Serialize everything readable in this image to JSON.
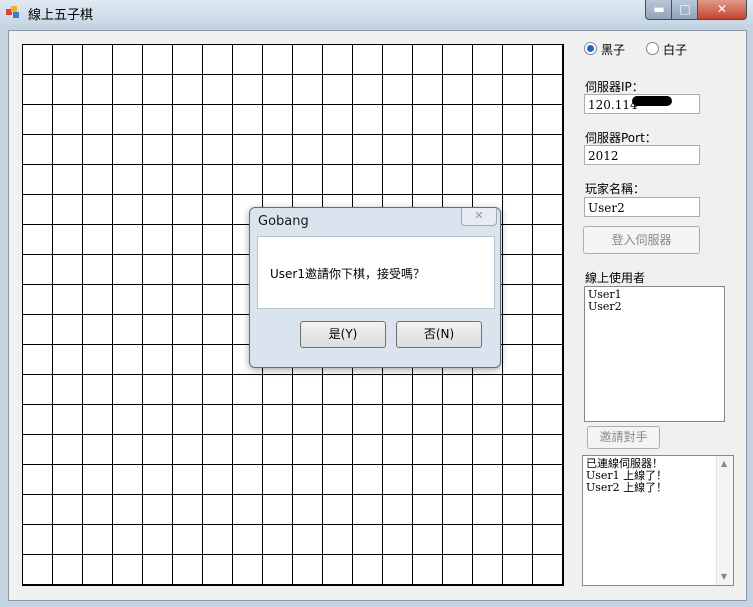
{
  "window": {
    "title": "線上五子棋"
  },
  "titlebar": {
    "min_glyph": "▬",
    "max_glyph": "□",
    "close_glyph": "✕"
  },
  "side": {
    "radio_black": "黑子",
    "radio_white": "白子",
    "selected": "黑子",
    "ip_label": "伺服器IP：",
    "ip_value": "120.114",
    "port_label": "伺服器Port：",
    "port_value": "2012",
    "name_label": "玩家名稱：",
    "name_value": "User2",
    "login_button": "登入伺服器",
    "users_label": "線上使用者",
    "users": [
      "User1",
      "User2"
    ],
    "invite_button": "邀請對手",
    "log": [
      "已連線伺服器！",
      "User1 上線了！",
      "User2 上線了！"
    ]
  },
  "dialog": {
    "title": "Gobang",
    "message": "User1邀請你下棋，接受嗎？",
    "yes_label": "是(Y)",
    "no_label": "否(N)",
    "close_glyph": "✕"
  },
  "board": {
    "rows": 18,
    "cols": 18
  },
  "colors": {
    "accent": "#2466b3",
    "close": "#c3442f"
  }
}
